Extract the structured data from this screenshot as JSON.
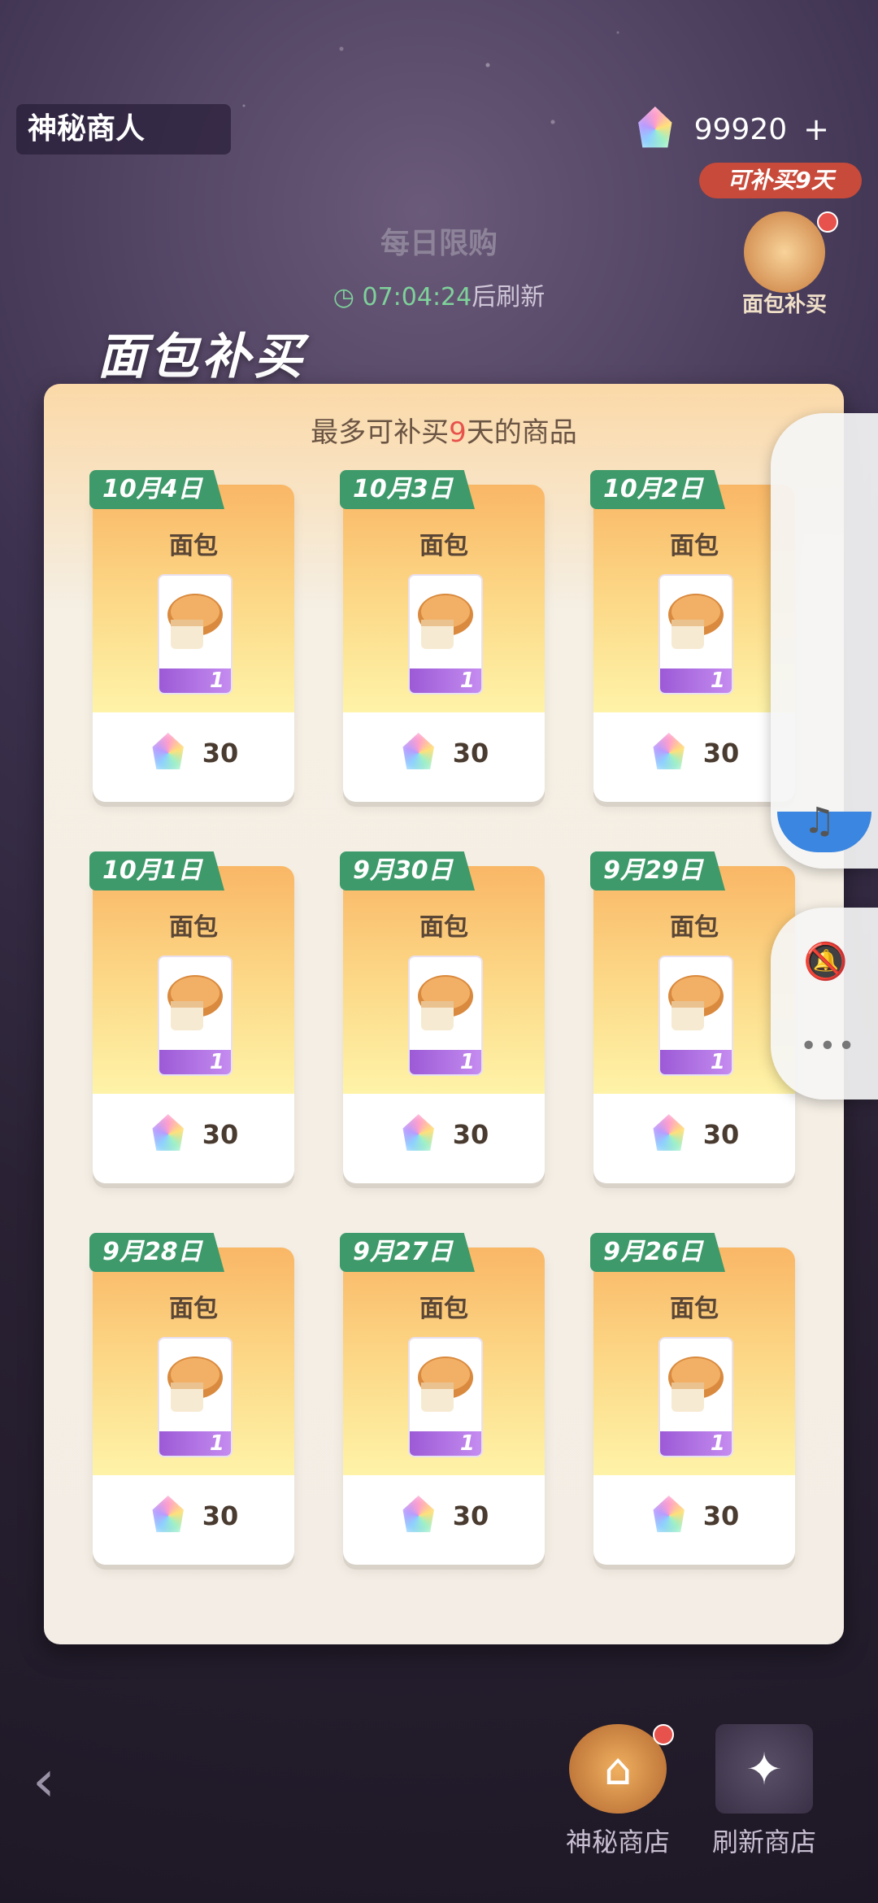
{
  "header": {
    "title": "神秘商人",
    "currency_value": "99920",
    "plus_label": "+",
    "replenish_badge": "可补买9天",
    "daily_title": "每日限购",
    "refresh_time": "07:04:24",
    "refresh_suffix": "后刷新",
    "bread_button_label": "面包补买"
  },
  "modal": {
    "heading": "面包补买",
    "subtitle_prefix": "最多可补买",
    "subtitle_days": "9",
    "subtitle_suffix": "天的商品",
    "cards": [
      {
        "date": "10月4日",
        "name": "面包",
        "qty": "1",
        "price": "30"
      },
      {
        "date": "10月3日",
        "name": "面包",
        "qty": "1",
        "price": "30"
      },
      {
        "date": "10月2日",
        "name": "面包",
        "qty": "1",
        "price": "30"
      },
      {
        "date": "10月1日",
        "name": "面包",
        "qty": "1",
        "price": "30"
      },
      {
        "date": "9月30日",
        "name": "面包",
        "qty": "1",
        "price": "30"
      },
      {
        "date": "9月29日",
        "name": "面包",
        "qty": "1",
        "price": "30"
      },
      {
        "date": "9月28日",
        "name": "面包",
        "qty": "1",
        "price": "30"
      },
      {
        "date": "9月27日",
        "name": "面包",
        "qty": "1",
        "price": "30"
      },
      {
        "date": "9月26日",
        "name": "面包",
        "qty": "1",
        "price": "30"
      }
    ]
  },
  "bottom": {
    "back_icon": "chevron-left-icon",
    "mystery_shop_label": "神秘商店",
    "refresh_shop_label": "刷新商店"
  },
  "side_widget": {
    "music_icon": "music-note-icon",
    "bell_icon": "bell-off-icon",
    "more_icon": "more-dots-icon"
  },
  "colors": {
    "accent_green": "#3e9a6a",
    "accent_red": "#e8524c",
    "card_gradient_top": "#f9b766"
  }
}
